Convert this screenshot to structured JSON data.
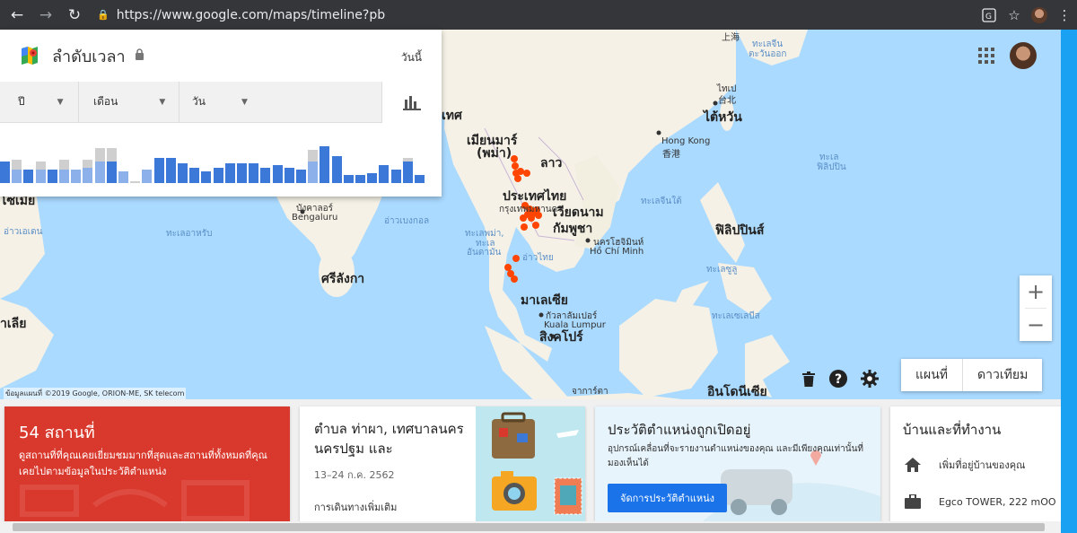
{
  "browser": {
    "url": "https://www.google.com/maps/timeline?pb",
    "back_icon": "arrow-left-icon",
    "forward_icon": "arrow-right-icon",
    "reload_icon": "reload-icon"
  },
  "timeline": {
    "title": "ลำดับเวลา",
    "today": "วันนี้",
    "filters": [
      "ปี",
      "เดือน",
      "วัน"
    ]
  },
  "map": {
    "labels": {
      "myanmar": "เมียนมาร์",
      "myanmar_sub": "(พม่า)",
      "laos": "ลาว",
      "thailand": "ประเทศไทย",
      "bangkok": "กรุงเทพมหานคร",
      "vietnam": "เวียดนาม",
      "cambodia": "กัมพูชา",
      "hcm_th": "นครโฮจิมินห์",
      "hcm_en": "Hồ Chí Minh",
      "bengaluru_th": "บังคาลอร์",
      "bengaluru_en": "Bengaluru",
      "srilanka": "ศรีลังกา",
      "malaysia": "มาเลเซีย",
      "kl_th": "กัวลาลัมเปอร์",
      "kl_en": "Kuala Lumpur",
      "singapore": "สิงคโปร์",
      "philippines": "ฟิลิปปินส์",
      "taiwan": "ไต้หวัน",
      "taipei_th": "ไทเป",
      "taipei_cn": "台北",
      "hongkong": "Hong Kong",
      "hongkong_cn": "香港",
      "indonesia": "อินโดนีเซีย",
      "jakarta": "จาการ์ตา",
      "india_partial": "เทศ",
      "maldives_partial": "าเลีย",
      "somalia_partial": "โซเมีย",
      "shanghai": "上海",
      "sea_east_china": "ทะเลจีน",
      "sea_east_china_sub": "ตะวันออก",
      "sea_arabian": "อ่าวเอเดน",
      "sea_arabian2": "ทะเลอาหรับ",
      "sea_bengal": "อ่าวเบงกอล",
      "sea_andaman": "ทะเลพม่า,",
      "sea_andaman2": "ทะเล",
      "sea_andaman3": "อันดามัน",
      "sea_gulf_thai": "อ่าวไทย",
      "sea_south_china": "ทะเลจีนใต้",
      "sea_sulu": "ทะเลซูลู",
      "sea_celebes": "ทะเลเซเลบีส",
      "sea_philippine": "ทะเล",
      "sea_philippine2": "ฟิลิปปิน",
      "copyright": "ข้อมูลแผนที่ ©2019 Google, ORION-ME, SK telecom"
    },
    "zoom_in": "+",
    "zoom_out": "−",
    "map_type": "แผนที่",
    "satellite": "ดาวเทียม"
  },
  "cards": {
    "places": {
      "count": "54 สถานที่",
      "desc": "ดูสถานที่ที่คุณเคยเยี่ยมชมมากที่สุดและสถานที่ทั้งหมดที่คุณเคยไปตามข้อมูลในประวัติตำแหน่ง"
    },
    "trip": {
      "title": "ตำบล ท่าผา, เทศบาลนครนครปฐม และ",
      "date": "13–24 ก.ค. 2562",
      "more": "การเดินทางเพิ่มเติม"
    },
    "history": {
      "title": "ประวัติตำแหน่งถูกเปิดอยู่",
      "desc": "อุปกรณ์เคลื่อนที่จะรายงานตำแหน่งของคุณ และมีเพียงคุณเท่านั้นที่มองเห็นได้",
      "button": "จัดการประวัติตำแหน่ง"
    },
    "home": {
      "title": "บ้านและที่ทำงาน",
      "add_home": "เพิ่มที่อยู่บ้านของคุณ",
      "work": "Egco TOWER, 222 mOO"
    }
  },
  "colors": {
    "bar_dark": "#3b78d8",
    "bar_mid": "#8cb0ea",
    "bar_light": "#cfcfcf",
    "pin": "#ff4500",
    "places_card": "#d9382c",
    "button_blue": "#1a73e8"
  }
}
